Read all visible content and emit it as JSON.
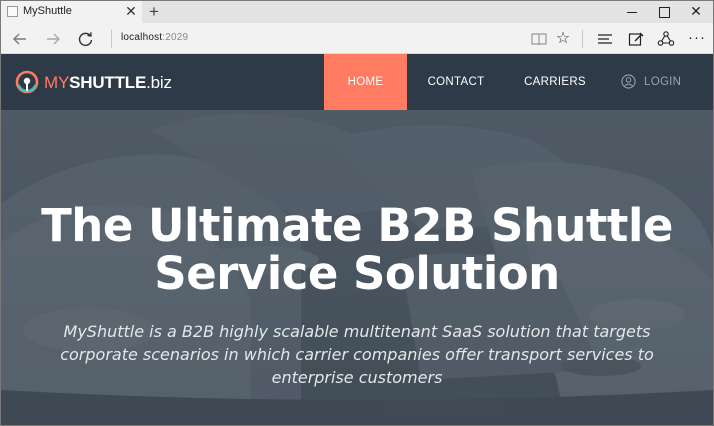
{
  "browser": {
    "tab_title": "MyShuttle",
    "tab_close": "✕",
    "new_tab": "+",
    "close_glyph": "✕",
    "address_host": "localhost",
    "address_port": ":2029",
    "more_glyph": "···",
    "star_glyph": "☆"
  },
  "site": {
    "logo": {
      "my": "MY",
      "shuttle": "SHUTTLE",
      "biz": ".biz"
    },
    "nav": {
      "home": "HOME",
      "contact": "CONTACT",
      "carriers": "CARRIERS",
      "login": "LOGIN"
    },
    "hero": {
      "title_line1": "The Ultimate B2B Shuttle",
      "title_line2": "Service Solution",
      "subtitle": "MyShuttle is a B2B highly scalable multitenant SaaS solution that targets corporate scenarios in which carrier companies offer transport services to enterprise customers"
    }
  },
  "colors": {
    "accent": "#ff7c62",
    "navbar": "#2e3a47",
    "hero_overlay": "#56616c"
  },
  "icons": [
    "back-arrow-icon",
    "forward-arrow-icon",
    "refresh-icon",
    "reading-view-icon",
    "favorite-star-icon",
    "hub-icon",
    "web-note-icon",
    "share-icon",
    "more-icon",
    "user-icon",
    "logo-icon"
  ]
}
